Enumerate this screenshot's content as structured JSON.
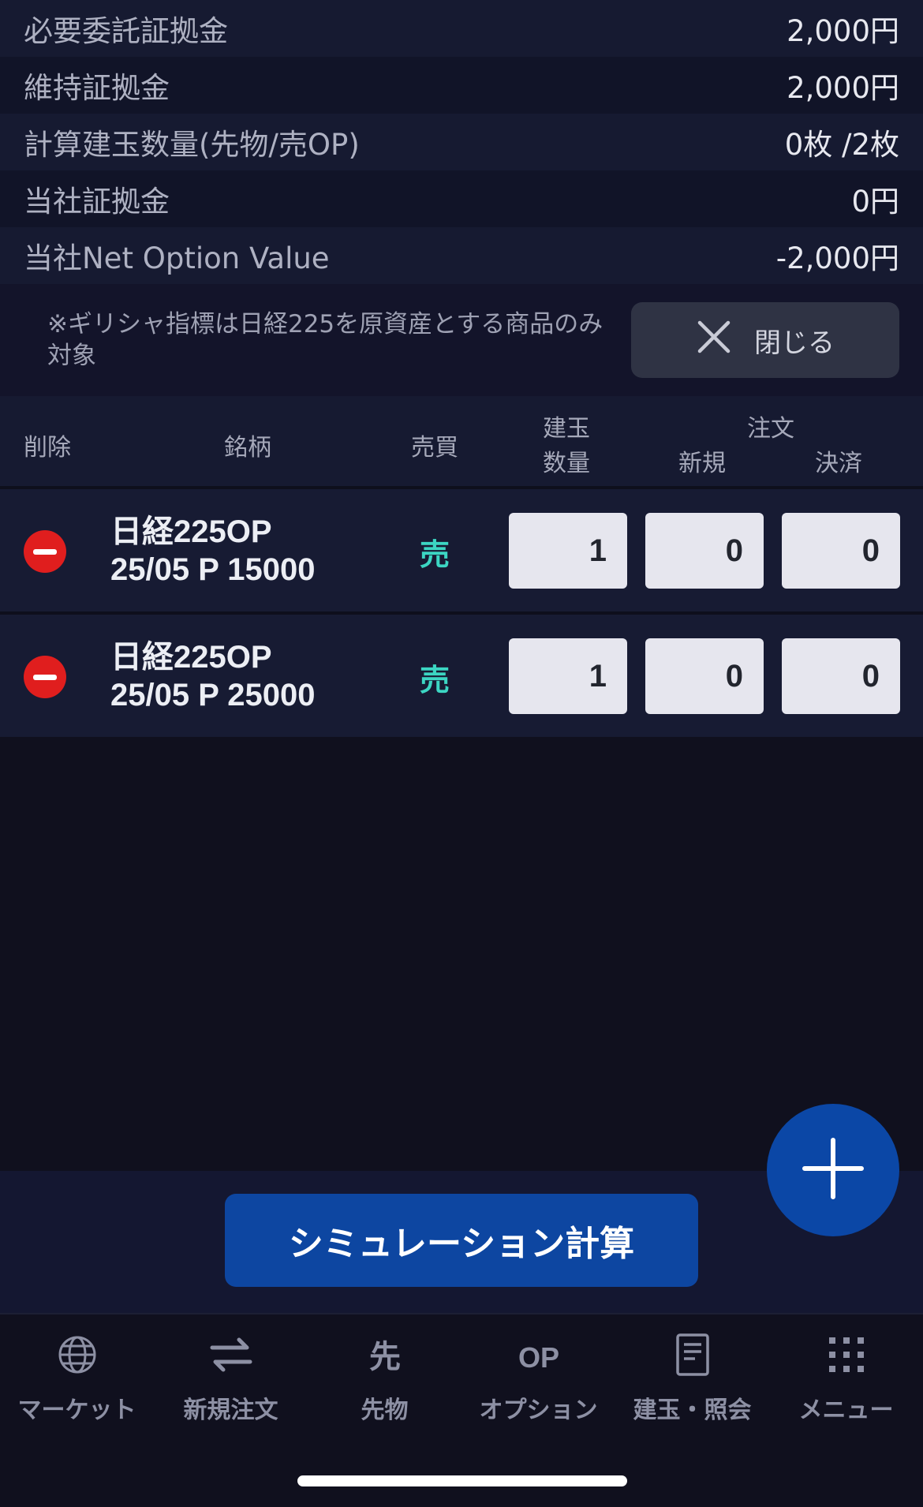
{
  "summary": [
    {
      "label": "必要委託証拠金",
      "value": "2,000円"
    },
    {
      "label": "維持証拠金",
      "value": "2,000円"
    },
    {
      "label": "計算建玉数量(先物/売OP)",
      "value": "0枚 /2枚"
    },
    {
      "label": "当社証拠金",
      "value": "0円"
    },
    {
      "label": "当社Net Option Value",
      "value": "-2,000円"
    }
  ],
  "note": {
    "text": "※ギリシャ指標は日経225を原資産とする商品のみ対象",
    "close_label": "閉じる"
  },
  "table": {
    "headers": {
      "delete": "削除",
      "symbol": "銘柄",
      "side": "売買",
      "position_qty_1": "建玉",
      "position_qty_2": "数量",
      "order": "注文",
      "new": "新規",
      "settle": "決済"
    },
    "rows": [
      {
        "name": "日経225OP",
        "contract": "25/05 P 15000",
        "side": "売",
        "position": "1",
        "new": "0",
        "settle": "0"
      },
      {
        "name": "日経225OP",
        "contract": "25/05 P 25000",
        "side": "売",
        "position": "1",
        "new": "0",
        "settle": "0"
      }
    ]
  },
  "simulation_button": "シミュレーション計算",
  "tabs": [
    {
      "label": "マーケット",
      "icon": "globe-icon"
    },
    {
      "label": "新規注文",
      "icon": "swap-arrows-icon"
    },
    {
      "label": "先物",
      "icon": "futures-icon"
    },
    {
      "label": "オプション",
      "icon": "option-icon"
    },
    {
      "label": "建玉・照会",
      "icon": "document-icon"
    },
    {
      "label": "メニュー",
      "icon": "grid-menu-icon"
    }
  ],
  "colors": {
    "sell": "#3cd6c3",
    "primary": "#0d46a1",
    "delete": "#e01e1e"
  }
}
